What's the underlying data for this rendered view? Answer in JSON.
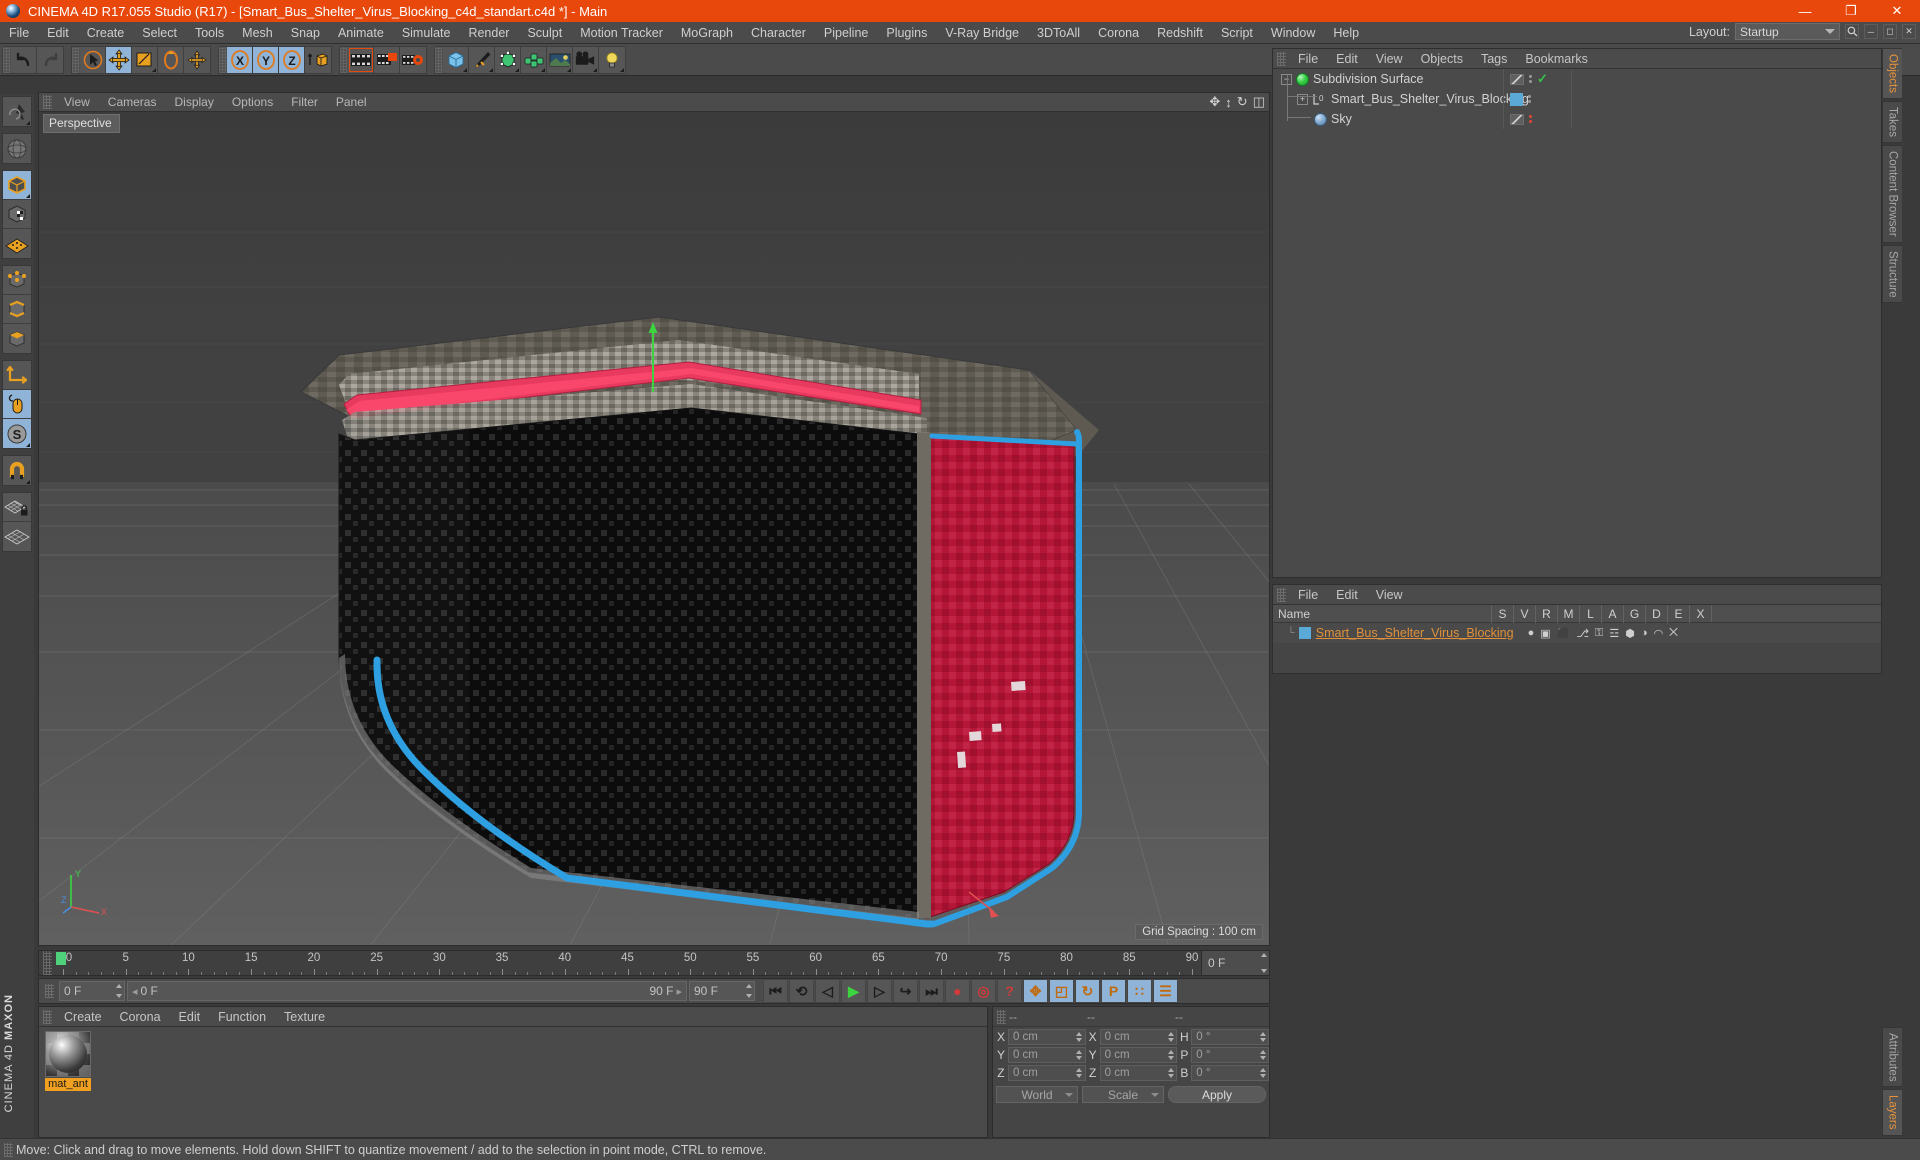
{
  "window": {
    "title": "CINEMA 4D R17.055 Studio (R17) - [Smart_Bus_Shelter_Virus_Blocking_c4d_standart.c4d *] - Main",
    "minimize": "—",
    "maximize": "❐",
    "close": "✕",
    "accent": "#e8480c"
  },
  "menubar": {
    "items": [
      "File",
      "Edit",
      "Create",
      "Select",
      "Tools",
      "Mesh",
      "Snap",
      "Animate",
      "Simulate",
      "Render",
      "Sculpt",
      "Motion Tracker",
      "MoGraph",
      "Character",
      "Pipeline",
      "Plugins",
      "V-Ray Bridge",
      "3DToAll",
      "Corona",
      "Redshift",
      "Script",
      "Window",
      "Help"
    ],
    "layout_label": "Layout:",
    "layout_value": "Startup",
    "search_icon": "search-icon"
  },
  "toolbar": {
    "groups": [
      {
        "name": "undo-redo",
        "buttons": [
          {
            "name": "undo-icon",
            "sel": false
          },
          {
            "name": "redo-icon",
            "sel": false
          }
        ]
      },
      {
        "name": "transform",
        "buttons": [
          {
            "name": "select-tool-icon",
            "sel": false
          },
          {
            "name": "move-tool-icon",
            "sel": true
          },
          {
            "name": "scale-tool-icon",
            "sel": false
          },
          {
            "name": "rotate-tool-icon",
            "sel": false
          },
          {
            "name": "free-move-icon",
            "sel": false
          }
        ]
      },
      {
        "name": "axis-locks",
        "buttons": [
          {
            "name": "x-axis-icon",
            "sel": true
          },
          {
            "name": "y-axis-icon",
            "sel": true
          },
          {
            "name": "z-axis-icon",
            "sel": true
          },
          {
            "name": "world-object-axis-icon",
            "sel": false
          }
        ]
      },
      {
        "name": "render",
        "buttons": [
          {
            "name": "render-view-icon",
            "sel": false
          },
          {
            "name": "render-to-picture-viewer-icon",
            "sel": false
          },
          {
            "name": "render-settings-icon",
            "sel": false
          }
        ]
      },
      {
        "name": "primitives",
        "buttons": [
          {
            "name": "cube-primitive-icon",
            "sel": false
          },
          {
            "name": "spline-pen-icon",
            "sel": false
          },
          {
            "name": "generator-icon",
            "sel": false
          },
          {
            "name": "deformer-icon",
            "sel": false
          },
          {
            "name": "environment-icon",
            "sel": false
          },
          {
            "name": "camera-icon",
            "sel": false
          },
          {
            "name": "light-icon",
            "sel": false
          }
        ]
      }
    ]
  },
  "left_toolbar": {
    "groups": [
      {
        "buttons": [
          {
            "name": "live-selection-icon",
            "sel": false
          }
        ]
      },
      {
        "buttons": [
          {
            "name": "world-axis-icon",
            "sel": false
          }
        ]
      },
      {
        "buttons": [
          {
            "name": "model-mode-icon",
            "sel": true
          },
          {
            "name": "texture-mode-icon",
            "sel": false
          },
          {
            "name": "workplane-mode-icon",
            "sel": false
          }
        ]
      },
      {
        "buttons": [
          {
            "name": "point-mode-icon",
            "sel": false
          },
          {
            "name": "edge-mode-icon",
            "sel": false
          },
          {
            "name": "polygon-mode-icon",
            "sel": false
          }
        ]
      },
      {
        "buttons": [
          {
            "name": "object-axis-icon",
            "sel": false
          },
          {
            "name": "viewport-solo-icon",
            "sel": true
          },
          {
            "name": "enable-snap-icon",
            "sel": true
          }
        ]
      },
      {
        "buttons": [
          {
            "name": "magnet-icon",
            "sel": false
          }
        ]
      },
      {
        "buttons": [
          {
            "name": "workplane-lock-icon",
            "sel": false
          },
          {
            "name": "workplane-icon",
            "sel": false
          }
        ]
      }
    ],
    "brand_line1": "MAXON",
    "brand_line2": "CINEMA 4D"
  },
  "viewport": {
    "menu": [
      "View",
      "Cameras",
      "Display",
      "Options",
      "Filter",
      "Panel"
    ],
    "view_label": "Perspective",
    "grid_spacing": "Grid Spacing : 100 cm",
    "icons": [
      "move-camera-icon",
      "dolly-camera-icon",
      "rotate-camera-icon",
      "toggle-layout-icon"
    ],
    "axis": {
      "x": "X",
      "y": "Y",
      "z": "Z"
    }
  },
  "object_manager": {
    "menu": [
      "File",
      "Edit",
      "View",
      "Objects",
      "Tags",
      "Bookmarks"
    ],
    "items": [
      {
        "label": "Subdivision Surface",
        "depth": 0,
        "expander": "−",
        "icon": "subdivision-surface-icon",
        "icon_color": "#3bd14a",
        "tag": "checkmark",
        "tag_color": "#35c24b",
        "dots_color": "#9a9a9a",
        "has_layer_swatch": false
      },
      {
        "label": "Smart_Bus_Shelter_Virus_Blocking",
        "depth": 1,
        "expander": "+",
        "icon": "null-object-icon",
        "icon_color": "#d0d0d0",
        "tag": "swatch",
        "tag_color": "#5aa9d6",
        "dots_color": "#9a9a9a",
        "has_layer_swatch": true
      },
      {
        "label": "Sky",
        "depth": 1,
        "expander": "",
        "icon": "sky-object-icon",
        "icon_color": "#8fb4d8",
        "tag": "none",
        "tag_color": "#e04a3a",
        "dots_color": "#e04a3a",
        "has_layer_swatch": false
      }
    ]
  },
  "layer_manager": {
    "menu": [
      "File",
      "Edit",
      "View"
    ],
    "columns": [
      "S",
      "V",
      "R",
      "M",
      "L",
      "A",
      "G",
      "D",
      "E",
      "X"
    ],
    "name_header": "Name",
    "rows": [
      {
        "label": "Smart_Bus_Shelter_Virus_Blocking",
        "color": "#5aa9d6"
      }
    ]
  },
  "right_tabs": {
    "upper": [
      {
        "label": "Objects",
        "active": true
      },
      {
        "label": "Takes",
        "active": false
      },
      {
        "label": "Content Browser",
        "active": false
      },
      {
        "label": "Structure",
        "active": false
      }
    ],
    "lower": [
      {
        "label": "Attributes",
        "active": false
      },
      {
        "label": "Layers",
        "active": true
      }
    ]
  },
  "timeline": {
    "ticks": [
      0,
      5,
      10,
      15,
      20,
      25,
      30,
      35,
      40,
      45,
      50,
      55,
      60,
      65,
      70,
      75,
      80,
      85,
      90
    ],
    "min": 0,
    "max": 90,
    "current_frame_marker": 0,
    "end_field": "0 F"
  },
  "transport": {
    "current_frame": "0 F",
    "range_start": "0 F",
    "range_end": "90 F",
    "preview_end": "90 F",
    "buttons": [
      {
        "name": "go-to-start-button",
        "glyph": "⏮",
        "sel": false
      },
      {
        "name": "play-backwards-button",
        "glyph": "⟲",
        "sel": false
      },
      {
        "name": "previous-frame-button",
        "glyph": "◁",
        "sel": false
      },
      {
        "name": "play-forward-button",
        "glyph": "▶",
        "sel": false
      },
      {
        "name": "next-frame-button",
        "glyph": "▷",
        "sel": false
      },
      {
        "name": "play-loop-button",
        "glyph": "↪",
        "sel": false
      },
      {
        "name": "go-to-end-button",
        "glyph": "⏭",
        "sel": false
      },
      {
        "name": "record-active-objects-button",
        "glyph": "●",
        "sel": false
      },
      {
        "name": "autokeying-button",
        "glyph": "◎",
        "sel": false
      },
      {
        "name": "keyframe-selection-button",
        "glyph": "?",
        "sel": false
      },
      {
        "name": "record-position-button",
        "glyph": "✥",
        "sel": true
      },
      {
        "name": "record-scale-button",
        "glyph": "◰",
        "sel": true
      },
      {
        "name": "record-rotation-button",
        "glyph": "↻",
        "sel": true
      },
      {
        "name": "record-parameter-button",
        "glyph": "P",
        "sel": true
      },
      {
        "name": "record-pla-button",
        "glyph": "∷",
        "sel": true
      },
      {
        "name": "timeline-toggle-button",
        "glyph": "☰",
        "sel": true
      }
    ]
  },
  "material_manager": {
    "menu": [
      "Create",
      "Corona",
      "Edit",
      "Function",
      "Texture"
    ],
    "materials": [
      {
        "name": "mat_ant",
        "label_color": "#f0a020"
      }
    ]
  },
  "coordinate_manager": {
    "header": [
      "--",
      "--",
      "--"
    ],
    "rows": [
      {
        "pos_label": "X",
        "pos_value": "0 cm",
        "size_label": "X",
        "size_value": "0 cm",
        "rot_label": "H",
        "rot_value": "0 °"
      },
      {
        "pos_label": "Y",
        "pos_value": "0 cm",
        "size_label": "Y",
        "size_value": "0 cm",
        "rot_label": "P",
        "rot_value": "0 °"
      },
      {
        "pos_label": "Z",
        "pos_value": "0 cm",
        "size_label": "Z",
        "size_value": "0 cm",
        "rot_label": "B",
        "rot_value": "0 °"
      }
    ],
    "system": "World",
    "mode": "Scale",
    "apply": "Apply"
  },
  "status_bar": {
    "message": "Move: Click and drag to move elements. Hold down SHIFT to quantize movement / add to the selection in point mode, CTRL to remove."
  }
}
